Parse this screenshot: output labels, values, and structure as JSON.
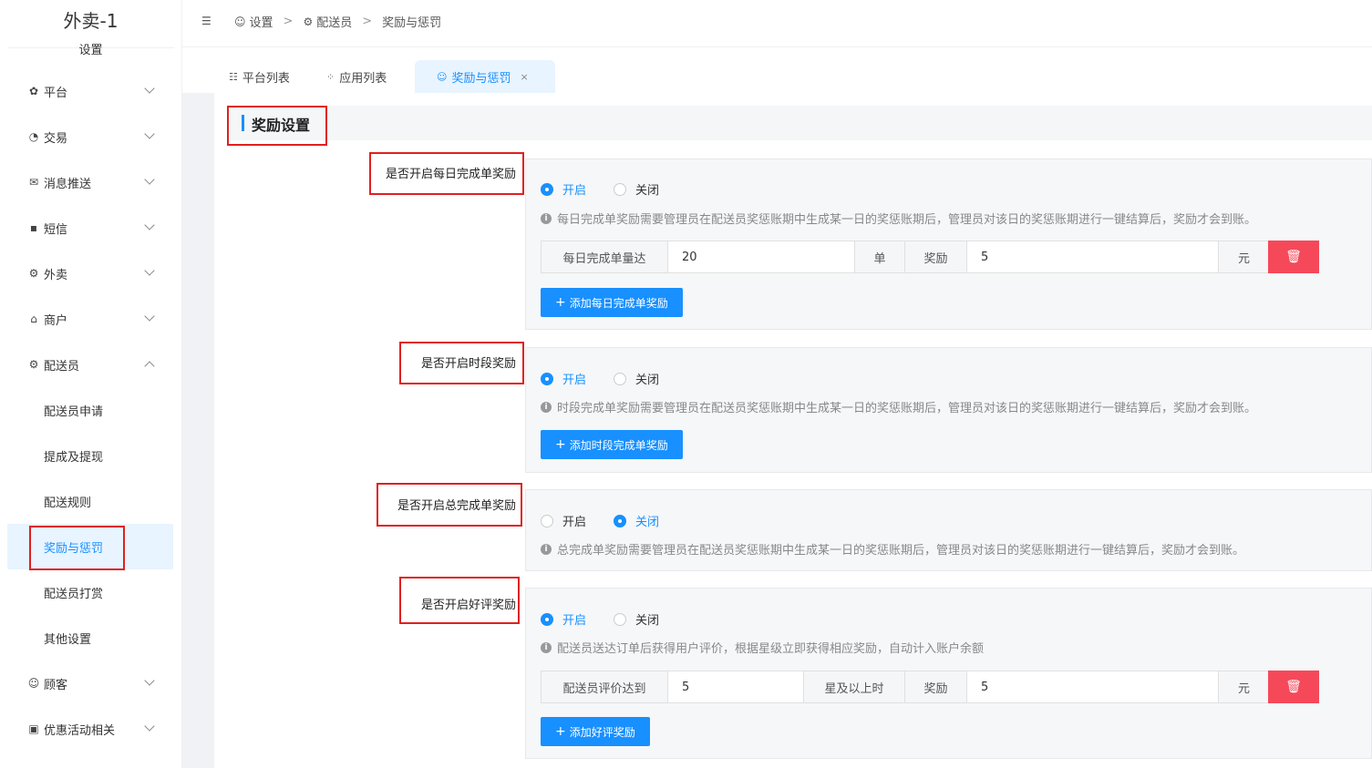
{
  "app": {
    "title": "外卖-1",
    "subtitle": "设置"
  },
  "sidebar": {
    "items": [
      {
        "label": "平台",
        "icon": "gear-icon"
      },
      {
        "label": "交易",
        "icon": "trade-icon"
      },
      {
        "label": "消息推送",
        "icon": "message-icon"
      },
      {
        "label": "短信",
        "icon": "sms-icon"
      },
      {
        "label": "外卖",
        "icon": "delivery-icon"
      },
      {
        "label": "商户",
        "icon": "shop-icon"
      },
      {
        "label": "配送员",
        "icon": "rider-icon"
      }
    ],
    "rider_sub": [
      "配送员申请",
      "提成及提现",
      "配送规则",
      "奖励与惩罚",
      "配送员打赏",
      "其他设置"
    ],
    "after": [
      {
        "label": "顾客",
        "icon": "user-icon"
      },
      {
        "label": "优惠活动相关",
        "icon": "gift-icon"
      }
    ]
  },
  "breadcrumb": {
    "b1": "设置",
    "b2": "配送员",
    "b3": "奖励与惩罚",
    "sep": ">"
  },
  "tabs": {
    "t1": "平台列表",
    "t2": "应用列表",
    "t3": "奖励与惩罚",
    "close": "×"
  },
  "section": {
    "title": "奖励设置"
  },
  "radio": {
    "on": "开启",
    "off": "关闭"
  },
  "rows": {
    "daily": {
      "label": "是否开启每日完成单奖励",
      "selected": "开启",
      "hint": "每日完成单奖励需要管理员在配送员奖惩账期中生成某一日的奖惩账期后，管理员对该日的奖惩账期进行一键结算后，奖励才会到账。",
      "addon1": "每日完成单量达",
      "value1": "20",
      "addon2": "单",
      "addon3": "奖励",
      "value2": "5",
      "addon4": "元",
      "add_button": "添加每日完成单奖励"
    },
    "period": {
      "label": "是否开启时段奖励",
      "selected": "开启",
      "hint": "时段完成单奖励需要管理员在配送员奖惩账期中生成某一日的奖惩账期后，管理员对该日的奖惩账期进行一键结算后，奖励才会到账。",
      "add_button": "添加时段完成单奖励"
    },
    "total": {
      "label": "是否开启总完成单奖励",
      "selected": "关闭",
      "hint": "总完成单奖励需要管理员在配送员奖惩账期中生成某一日的奖惩账期后，管理员对该日的奖惩账期进行一键结算后，奖励才会到账。"
    },
    "review": {
      "label": "是否开启好评奖励",
      "selected": "开启",
      "hint": "配送员送达订单后获得用户评价，根据星级立即获得相应奖励，自动计入账户余额",
      "addon1": "配送员评价达到",
      "value1": "5",
      "addon2": "星及以上时",
      "addon3": "奖励",
      "value2": "5",
      "addon4": "元",
      "add_button": "添加好评奖励"
    }
  },
  "colors": {
    "accent": "#1890ff",
    "danger": "#f5495a",
    "highlight": "#e02020"
  }
}
